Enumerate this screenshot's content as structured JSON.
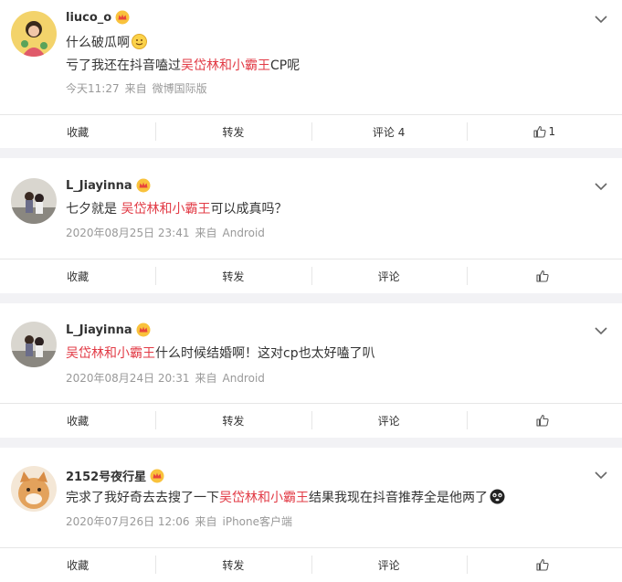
{
  "comments": [
    {
      "username": "liuco_o",
      "line1_text": "什么破瓜啊",
      "line2_pre": "亏了我还在抖音嗑过",
      "line2_hl": "吴岱林和小霸王",
      "line2_post": "CP呢",
      "time": "今天11:27",
      "source_prefix": "来自",
      "source": "微博国际版",
      "actions": {
        "collect": "收藏",
        "repost": "转发",
        "comment": "评论 4",
        "like_count": "1"
      }
    },
    {
      "username": "L_Jiayinna",
      "line1_pre": "七夕就是 ",
      "line1_hl": "吴岱林和小霸王",
      "line1_post": "可以成真吗？",
      "time": "2020年08月25日 23:41",
      "source_prefix": "来自",
      "source": "Android",
      "actions": {
        "collect": "收藏",
        "repost": "转发",
        "comment": "评论",
        "like_count": ""
      }
    },
    {
      "username": "L_Jiayinna",
      "line1_hl": "吴岱林和小霸王",
      "line1_post": "什么时候结婚啊！这对cp也太好嗑了叭",
      "time": "2020年08月24日 20:31",
      "source_prefix": "来自",
      "source": "Android",
      "actions": {
        "collect": "收藏",
        "repost": "转发",
        "comment": "评论",
        "like_count": ""
      }
    },
    {
      "username": "2152号夜行星",
      "line1_pre": "完求了我好奇去去搜了一下",
      "line1_hl": "吴岱林和小霸王",
      "line1_post": "结果我现在抖音推荐全是他两了",
      "time": "2020年07月26日 12:06",
      "source_prefix": "来自",
      "source": "iPhone客户端",
      "actions": {
        "collect": "收藏",
        "repost": "转发",
        "comment": "评论",
        "like_count": ""
      }
    }
  ],
  "colors": {
    "highlight": "#e23b46",
    "meta": "#999999",
    "background": "#f2f2f5"
  }
}
